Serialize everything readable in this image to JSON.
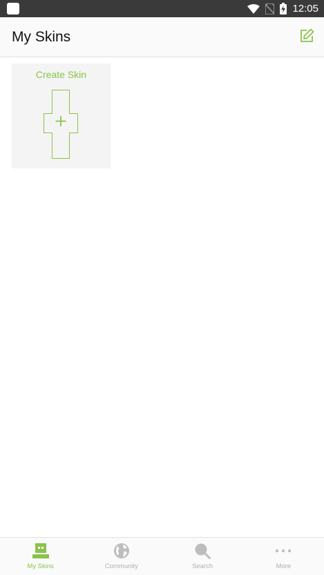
{
  "status_bar": {
    "time": "12:05",
    "icons": [
      "app-notification-icon",
      "wifi-icon",
      "no-sim-icon",
      "battery-charging-icon"
    ]
  },
  "app_bar": {
    "title": "My Skins",
    "action_icon": "edit-icon"
  },
  "main": {
    "create_card": {
      "label": "Create Skin",
      "icon": "plus-icon"
    }
  },
  "bottom_nav": {
    "items": [
      {
        "label": "My Skins",
        "icon": "skin-head-icon",
        "active": true
      },
      {
        "label": "Community",
        "icon": "globe-icon",
        "active": false
      },
      {
        "label": "Search",
        "icon": "search-icon",
        "active": false
      },
      {
        "label": "More",
        "icon": "more-dots-icon",
        "active": false
      }
    ]
  },
  "colors": {
    "accent": "#8bc34a",
    "inactive": "#b0b0b0",
    "status_bar": "#3a3a3a",
    "app_bar": "#fafafa",
    "card": "#f4f4f4"
  }
}
